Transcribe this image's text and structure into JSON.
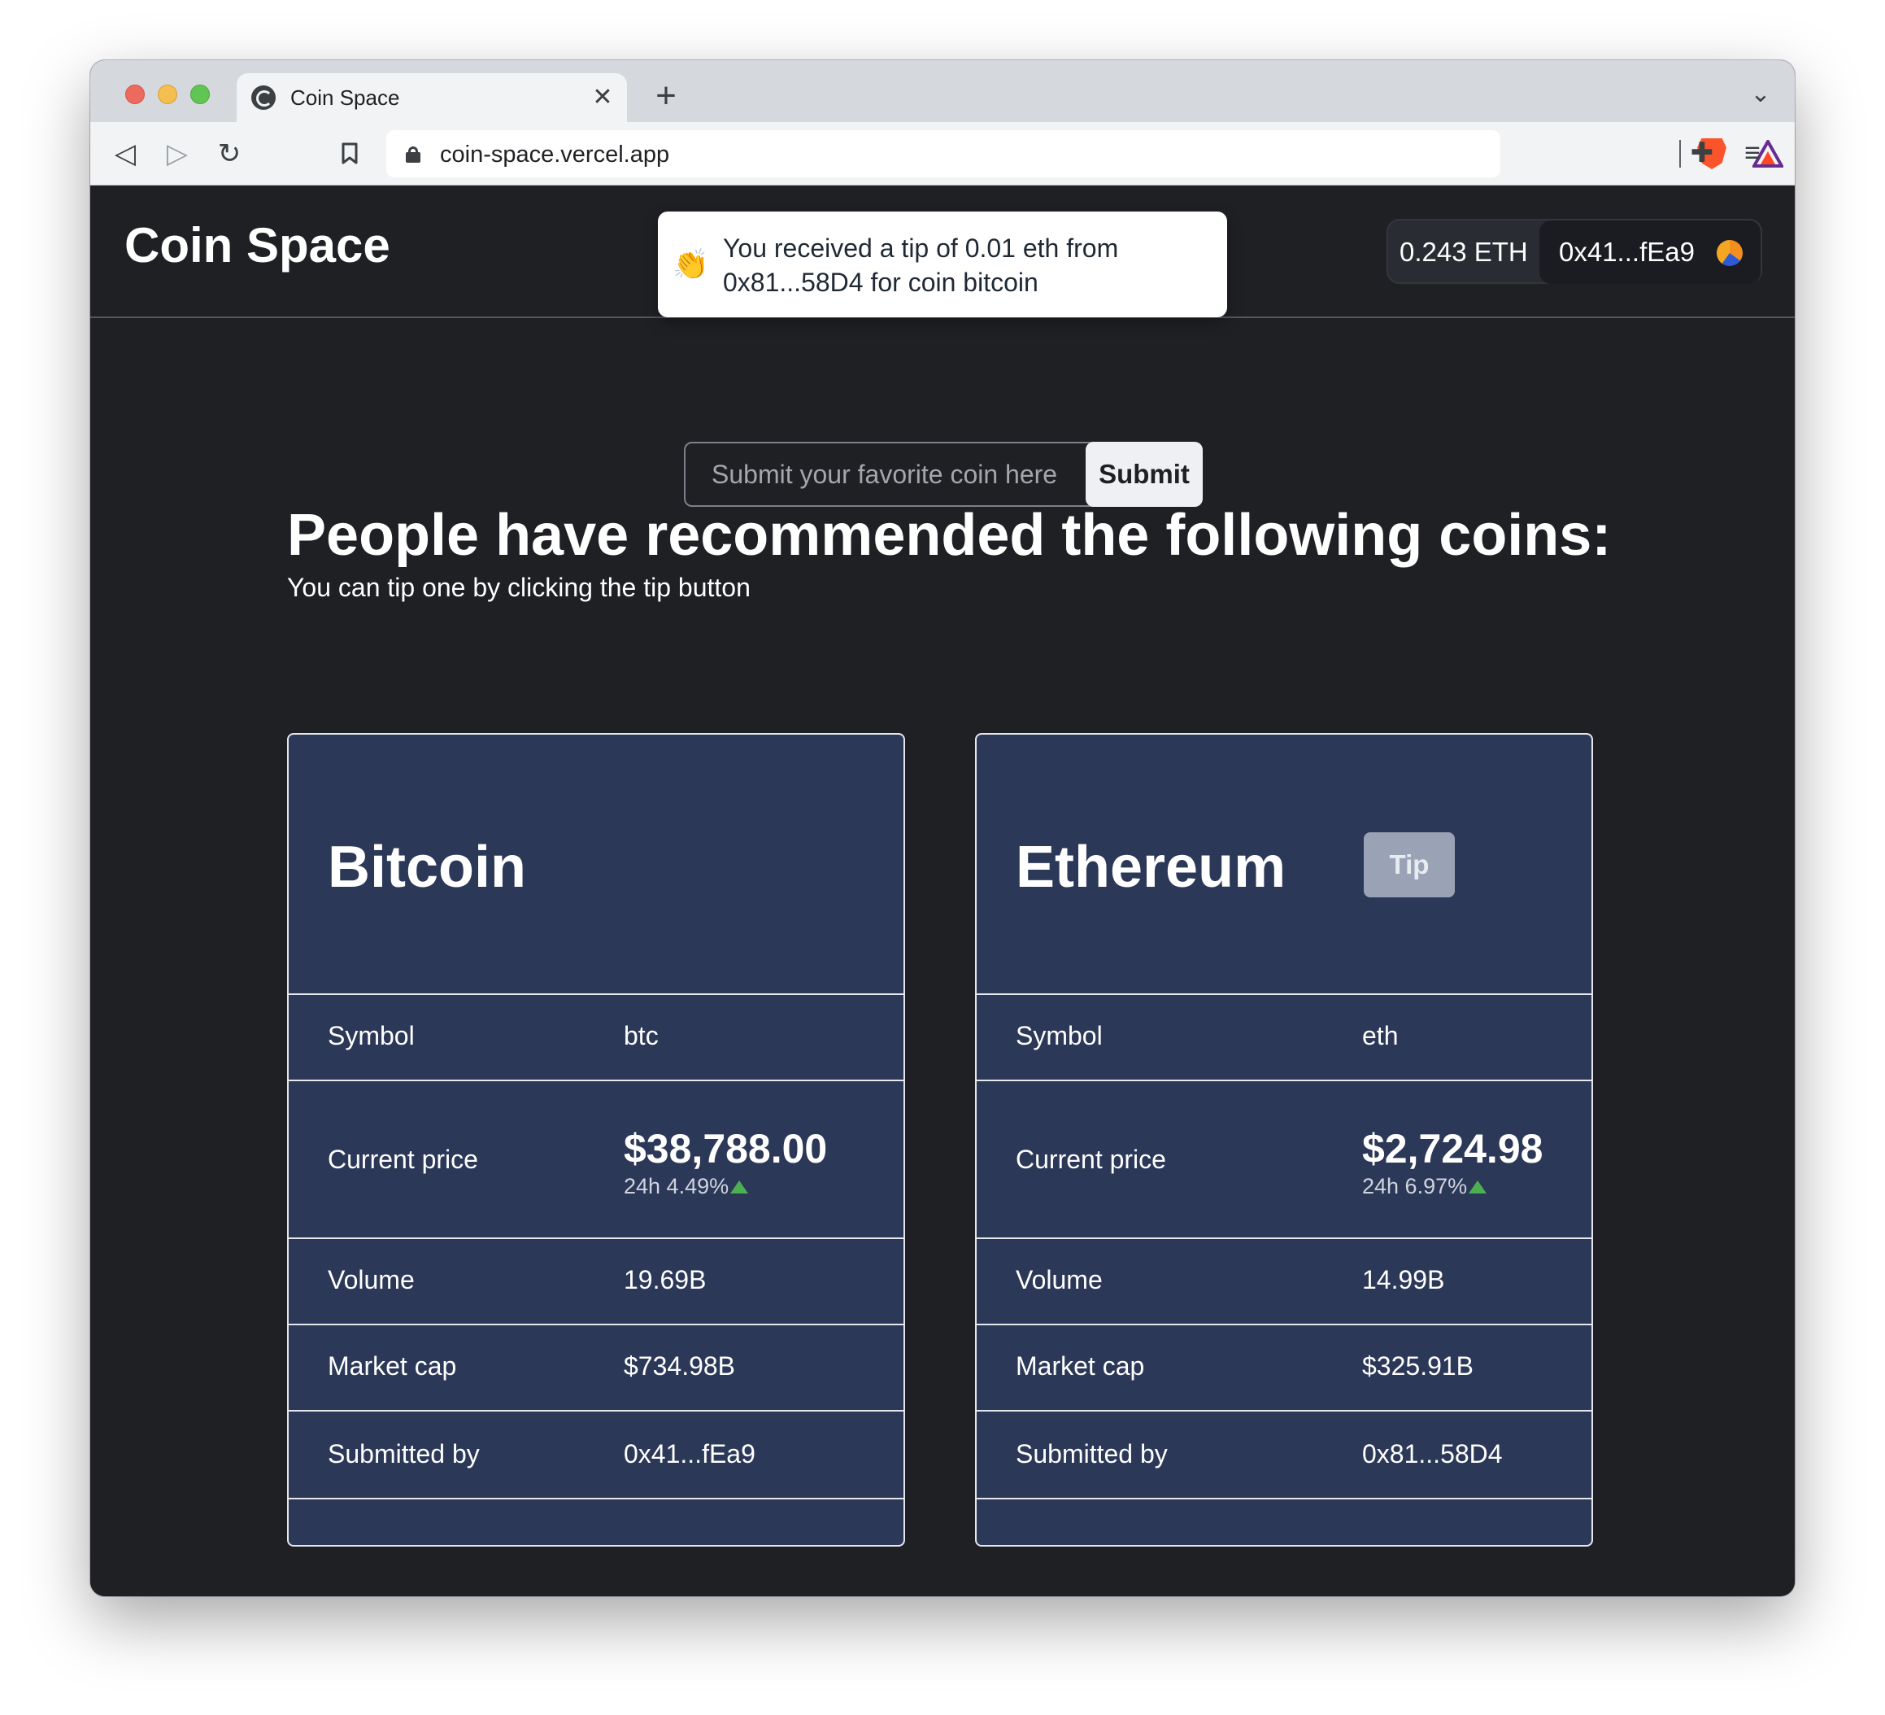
{
  "browser": {
    "tab_title": "Coin Space",
    "url": "coin-space.vercel.app"
  },
  "site": {
    "title": "Coin Space",
    "wallet_balance": "0.243 ETH",
    "wallet_address": "0x41...fEa9"
  },
  "toast": {
    "message": "You received a tip of 0.01 eth from 0x81...58D4 for coin bitcoin"
  },
  "submit_form": {
    "placeholder": "Submit your favorite coin here",
    "button_label": "Submit"
  },
  "main": {
    "heading": "People have recommended the following coins:",
    "subheading": "You can tip one by clicking the tip button"
  },
  "labels": {
    "symbol": "Symbol",
    "current_price": "Current price",
    "volume": "Volume",
    "market_cap": "Market cap",
    "submitted_by": "Submitted by",
    "tip": "Tip"
  },
  "coins": [
    {
      "name": "Bitcoin",
      "symbol": "btc",
      "price": "$38,788.00",
      "change": "24h 4.49%",
      "volume": "19.69B",
      "market_cap": "$734.98B",
      "submitted_by": "0x41...fEa9"
    },
    {
      "name": "Ethereum",
      "symbol": "eth",
      "price": "$2,724.98",
      "change": "24h 6.97%",
      "volume": "14.99B",
      "market_cap": "$325.91B",
      "submitted_by": "0x81...58D4"
    }
  ],
  "colors": {
    "page_bg": "#1f2024",
    "card_bg": "#2c3858",
    "positive_change": "#4caf50"
  }
}
